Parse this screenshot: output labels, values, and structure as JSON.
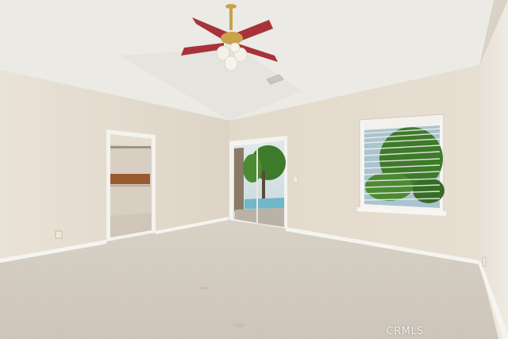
{
  "watermark": "CRMLS",
  "colors": {
    "ceiling": "#ecebe6",
    "ceiling_shade": "#dcdad4",
    "wall_left": "#e7e0d4",
    "wall_back": "#e4dbcd",
    "wall_right": "#ebe6dd",
    "carpet": "#d6cfc4",
    "baseboard": "#f7f5f1",
    "fan_blade": "#a8323a",
    "fan_brass": "#c9a24a",
    "foliage": "#3d7a2a",
    "pool": "#6fb7c9"
  },
  "icons": {
    "fan": "ceiling-fan-icon",
    "vent": "ceiling-vent-icon",
    "outlet": "wall-outlet-icon",
    "switch": "light-switch-icon"
  }
}
